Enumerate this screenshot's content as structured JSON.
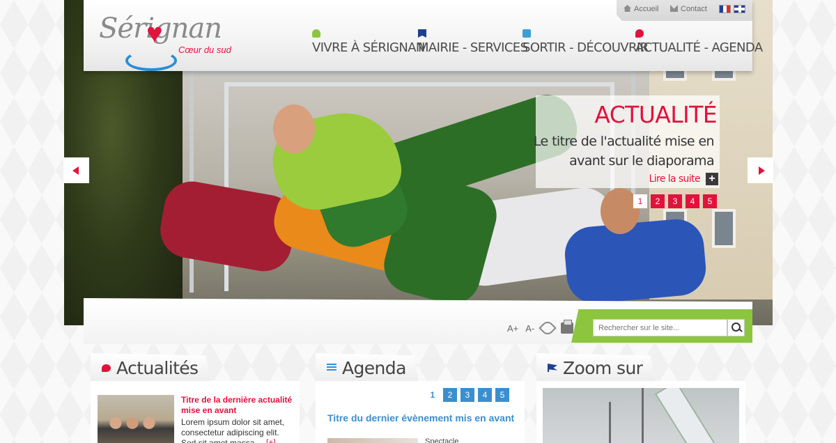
{
  "brand": {
    "logo_text": "Sérignan",
    "tagline": "Cœur du sud"
  },
  "topbar": {
    "home_label": "Accueil",
    "contact_label": "Contact",
    "languages": [
      "fr",
      "en"
    ]
  },
  "nav": [
    {
      "label": "VIVRE À SÉRIGNAN",
      "icon": "person-icon",
      "color": "#8cc63f"
    },
    {
      "label": "MAIRIE - SERVICES",
      "icon": "bookmark-icon",
      "color": "#1f3f8f"
    },
    {
      "label": "SORTIR - DÉCOUVRIR",
      "icon": "camera-icon",
      "color": "#3aa0d8"
    },
    {
      "label": "ACTUALITÉ - AGENDA",
      "icon": "speech-bubble-icon",
      "color": "#e2123b"
    }
  ],
  "slide": {
    "category": "ACTUALITÉ",
    "title": "Le titre de l'actualité mise en avant sur le diaporama",
    "read_more": "Lire la suite",
    "pages": [
      "1",
      "2",
      "3",
      "4",
      "5"
    ],
    "active_page": 1
  },
  "tools": {
    "font_increase": "A+",
    "font_decrease": "A-"
  },
  "search": {
    "placeholder": "Rechercher sur le site..."
  },
  "columns": {
    "news": {
      "heading": "Actualités",
      "title": "Titre de la dernière actualité mise en avant",
      "text": "Lorem ipsum dolor sit amet, consectetur adipiscing elit. Sed sit amet massa",
      "more": "[+]"
    },
    "agenda": {
      "heading": "Agenda",
      "pages": [
        "1",
        "2",
        "3",
        "4",
        "5"
      ],
      "active_page": 1,
      "title": "Titre du dernier évènement mis en avant",
      "type": "Spectacle"
    },
    "zoom": {
      "heading": "Zoom sur"
    }
  },
  "colors": {
    "accent_red": "#e2123b",
    "accent_green": "#8cc63f",
    "accent_blue": "#3a8fd0"
  }
}
